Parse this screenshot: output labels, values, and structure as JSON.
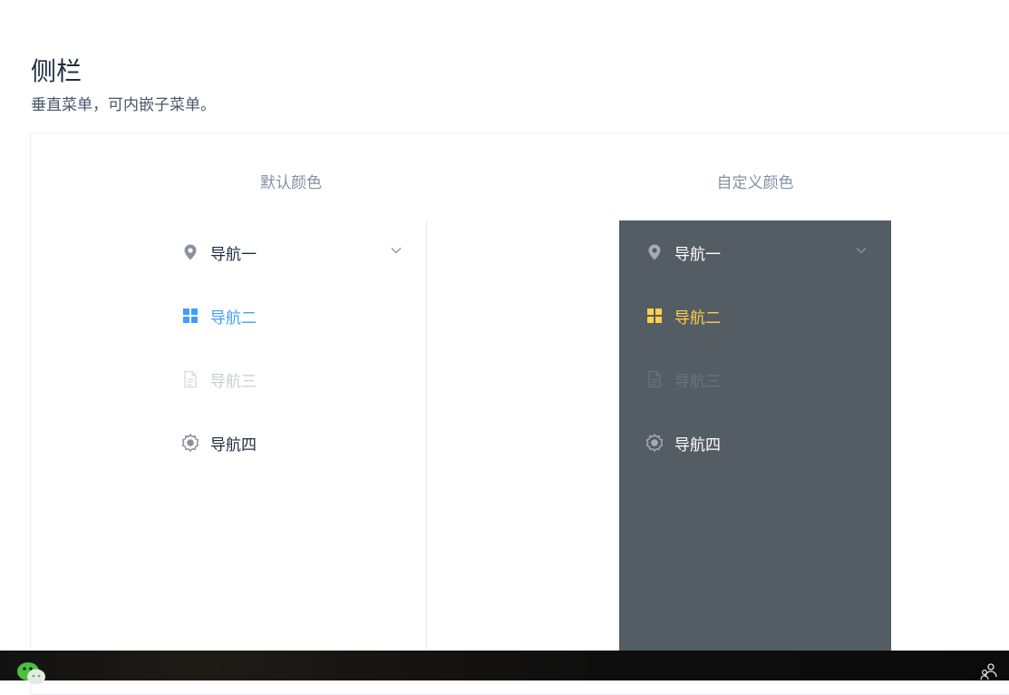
{
  "page": {
    "title": "侧栏",
    "description": "垂直菜单，可内嵌子菜单。"
  },
  "demo": {
    "default_menu": {
      "title": "默认颜色",
      "items": [
        {
          "label": "导航一",
          "icon": "location-icon",
          "state": "normal",
          "has_submenu": true
        },
        {
          "label": "导航二",
          "icon": "grid-icon",
          "state": "active"
        },
        {
          "label": "导航三",
          "icon": "document-icon",
          "state": "disabled"
        },
        {
          "label": "导航四",
          "icon": "setting-icon",
          "state": "normal"
        }
      ],
      "colors": {
        "background": "#ffffff",
        "text": "#1f2d3d",
        "active": "#409eff",
        "disabled": "#c8cdd3"
      }
    },
    "custom_menu": {
      "title": "自定义颜色",
      "items": [
        {
          "label": "导航一",
          "icon": "location-icon",
          "state": "normal",
          "has_submenu": true
        },
        {
          "label": "导航二",
          "icon": "grid-icon",
          "state": "active"
        },
        {
          "label": "导航三",
          "icon": "document-icon",
          "state": "disabled"
        },
        {
          "label": "导航四",
          "icon": "setting-icon",
          "state": "normal"
        }
      ],
      "colors": {
        "background": "#545c64",
        "text": "#ffffff",
        "active": "#ffd04b",
        "disabled": "#6b737b"
      }
    }
  },
  "taskbar": {
    "icons": [
      "wechat-icon",
      "people-icon"
    ]
  }
}
